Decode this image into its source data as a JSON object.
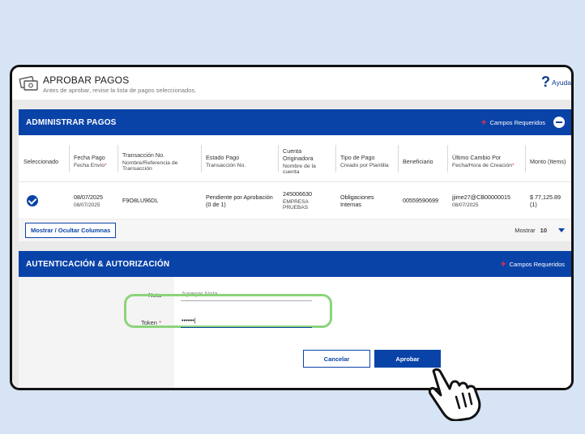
{
  "header": {
    "title": "APROBAR PAGOS",
    "subtitle": "Antes de aprobar, revise la lista de pagos seleccionados.",
    "help_label": "Ayuda",
    "help_icon": "?"
  },
  "manage_panel": {
    "title": "ADMINISTRAR PAGOS",
    "required_label": "Campos Requeridos",
    "columns": [
      {
        "label": "Seleccionado",
        "sub": ""
      },
      {
        "label": "Fecha Pago",
        "sub": "Fecha Envío"
      },
      {
        "label": "Transacción No.",
        "sub": "Nombre/Referencia de Transacción"
      },
      {
        "label": "Estado Pago",
        "sub": "Transacción No."
      },
      {
        "label": "Cuenta Originadora",
        "sub": "Nombre de la cuenta"
      },
      {
        "label": "Tipo de Pago",
        "sub": "Creado por Plantilla"
      },
      {
        "label": "Beneficiario",
        "sub": ""
      },
      {
        "label": "Último Cambio Por",
        "sub": "Fecha/Hora de Creación"
      },
      {
        "label": "Monto (Items)",
        "sub": ""
      }
    ],
    "row": {
      "fecha_pago": "08/07/2025",
      "fecha_envio": "08/07/2025",
      "transaccion": "F9O8LU96DL",
      "estado": "Pendiente por Aprobación (0 de 1)",
      "cuenta": "245006630",
      "cuenta_nombre": "EMPRESA PRUEBAS",
      "tipo_pago": "Obligaciones Internas",
      "beneficiario": "00559590699",
      "ultimo_cambio": "jjime27@CB00000015",
      "fecha_creacion": "08/07/2025",
      "monto": "$ 77,125.89 (1)"
    },
    "toggle_columns_label": "Mostrar / Ocultar Columnas",
    "show_label": "Mostrar",
    "show_value": "10"
  },
  "auth_panel": {
    "title": "AUTENTICACIÓN & AUTORIZACIÓN",
    "required_label": "Campos Requeridos",
    "note_label": "Nota",
    "note_placeholder": "Agregar Nota",
    "token_label": "Token",
    "token_value": "••••••|",
    "cancel_label": "Cancelar",
    "approve_label": "Aprobar"
  },
  "colors": {
    "primary": "#0a43a8",
    "required": "#e03048",
    "highlight": "#8cd47c",
    "background": "#d6e4f5"
  }
}
